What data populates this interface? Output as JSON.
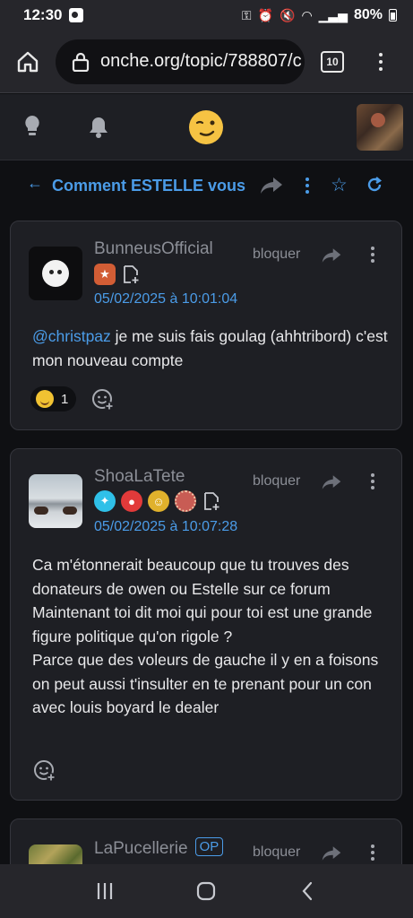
{
  "status_bar": {
    "time": "12:30",
    "battery": "80%"
  },
  "browser": {
    "url": "onche.org/topic/788807/c",
    "tab_count": "10"
  },
  "topic": {
    "title": "Comment ESTELLE vous"
  },
  "posts": [
    {
      "username": "BunneusOfficial",
      "block_label": "bloquer",
      "date": "05/02/2025 à 10:01:04",
      "mention": "@christpaz",
      "body": " je me suis fais goulag (ahhtribord) c'est mon nouveau compte",
      "reaction_count": "1"
    },
    {
      "username": "ShoaLaTete",
      "block_label": "bloquer",
      "date": "05/02/2025 à 10:07:28",
      "body_lines": [
        "Ca m'étonnerait beaucoup que tu trouves des donateurs de owen ou Estelle sur ce forum",
        "Maintenant toi dit moi qui pour toi est une grande figure politique qu'on rigole ?",
        "Parce que des voleurs de gauche il y en a foisons on peut aussi t'insulter en te prenant pour un con avec louis boyard le dealer"
      ]
    },
    {
      "username": "LaPucellerie",
      "op_label": "OP",
      "block_label": "bloquer"
    }
  ],
  "colors": {
    "accent": "#4b9ce8",
    "card_bg": "#1e1f24",
    "page_bg": "#0f1013"
  }
}
